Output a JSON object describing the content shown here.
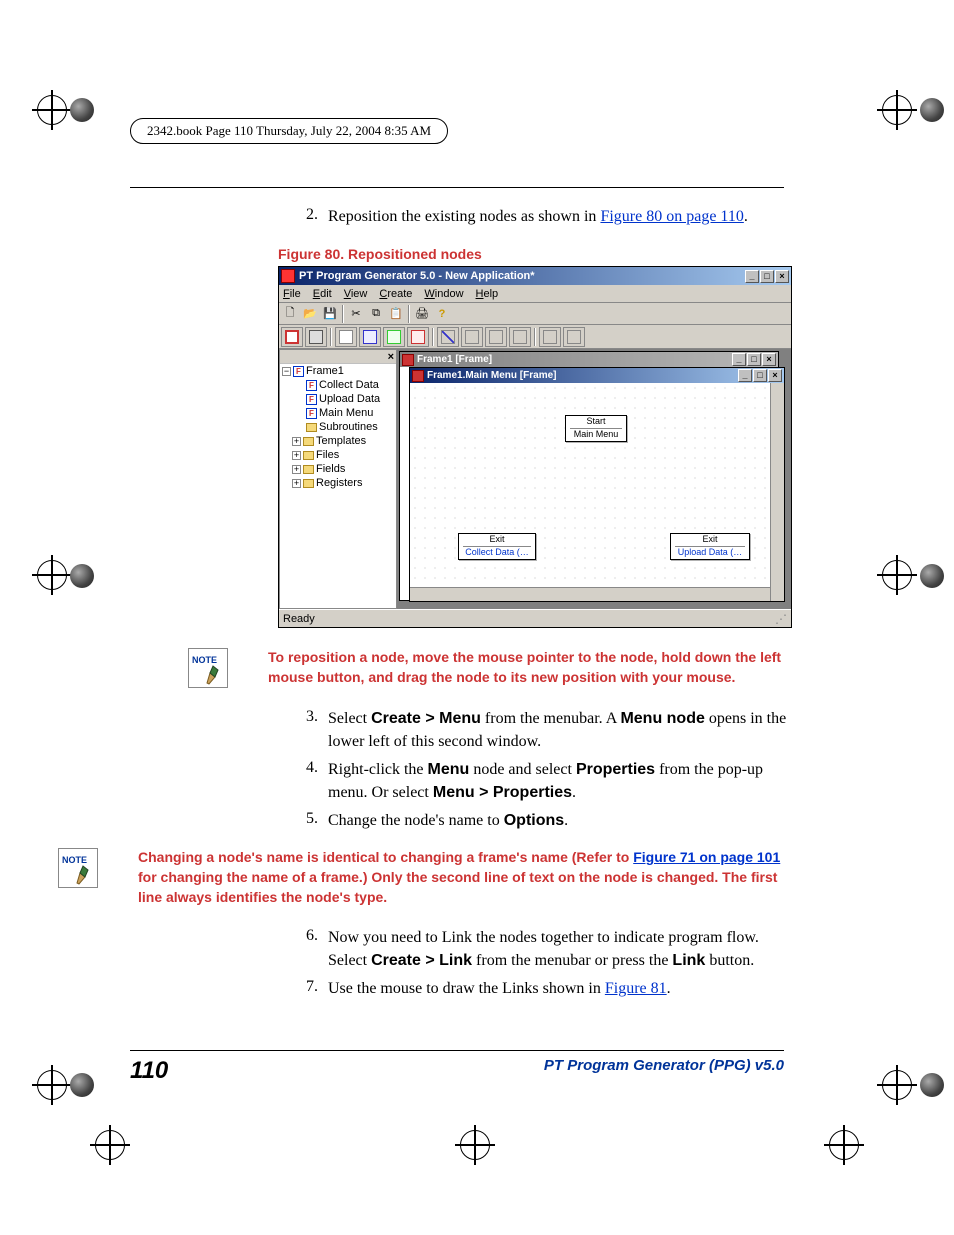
{
  "book_header": "2342.book  Page 110  Thursday, July 22, 2004  8:35 AM",
  "steps_top": {
    "num": "2.",
    "prefix": "Reposition the existing nodes as shown in ",
    "link": "Figure 80 on page 110",
    "suffix": "."
  },
  "figure_caption": "Figure 80. Repositioned nodes",
  "app": {
    "title": "PT Program Generator 5.0 - New Application*",
    "menu": [
      "File",
      "Edit",
      "View",
      "Create",
      "Window",
      "Help"
    ],
    "menu_underline": [
      "F",
      "E",
      "V",
      "C",
      "W",
      "H"
    ],
    "tree": {
      "close": "×",
      "root": "Frame1",
      "children": [
        "Collect Data",
        "Upload Data",
        "Main Menu",
        "Subroutines"
      ],
      "folders": [
        "Templates",
        "Files",
        "Fields",
        "Registers"
      ]
    },
    "child1_title": "Frame1 [Frame]",
    "child2_title": "Frame1.Main Menu [Frame]",
    "nodes": {
      "start": {
        "top": "Start",
        "bot": "Main Menu"
      },
      "exit1": {
        "top": "Exit",
        "bot": "Collect Data (…"
      },
      "exit2": {
        "top": "Exit",
        "bot": "Upload Data (…"
      }
    },
    "status": "Ready"
  },
  "note1": "To reposition a node, move the mouse pointer to the node, hold down the left mouse button, and drag the node to its new position with your mouse.",
  "step3": {
    "num": "3.",
    "p1": "Select ",
    "b1": "Create > Menu",
    "p2": " from the menubar. A ",
    "b2": "Menu node",
    "p3": " opens in the lower left of this second window."
  },
  "step4": {
    "num": "4.",
    "p1": "Right-click the ",
    "b1": "Menu",
    "p2": " node and select ",
    "b2": "Properties",
    "p3": " from the pop-up menu. Or select ",
    "b3": "Menu > Properties",
    "p4": "."
  },
  "step5": {
    "num": "5.",
    "p1": "Change the node's name to ",
    "b1": "Options",
    "p2": "."
  },
  "note2": {
    "p1": "Changing a node's name is identical to changing a frame's name (Refer to ",
    "link": "Figure 71 on page 101",
    "p2": " for changing the name of a frame.) Only the second line of text on the node is changed. The first line always identifies the node's type."
  },
  "step6": {
    "num": "6.",
    "p1": "Now you need to Link the nodes together to indicate program flow. Select ",
    "b1": "Create > Link",
    "p2": " from the menubar or press the ",
    "b2": "Link",
    "p3": " button."
  },
  "step7": {
    "num": "7.",
    "p1": "Use the mouse to draw the Links shown in ",
    "link": "Figure 81",
    "p2": "."
  },
  "footer": {
    "page": "110",
    "text": "PT Program Generator (PPG)  v5.0"
  },
  "note_label": "NOTE"
}
